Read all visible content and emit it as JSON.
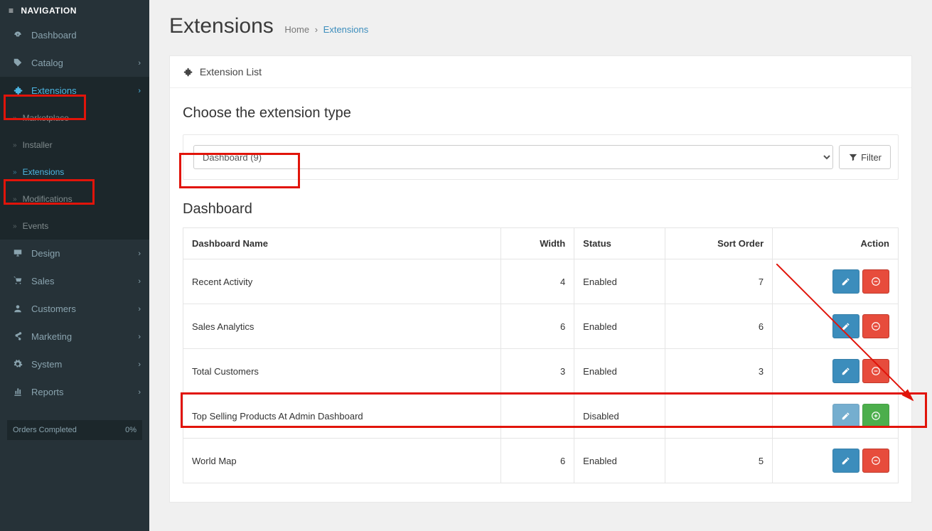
{
  "nav": {
    "header": "NAVIGATION",
    "items": [
      {
        "icon": "dashboard",
        "label": "Dashboard",
        "expand": false
      },
      {
        "icon": "tag",
        "label": "Catalog",
        "expand": true
      },
      {
        "icon": "puzzle",
        "label": "Extensions",
        "expand": true,
        "active": true
      },
      {
        "icon": "desktop",
        "label": "Design",
        "expand": true
      },
      {
        "icon": "cart",
        "label": "Sales",
        "expand": true
      },
      {
        "icon": "user",
        "label": "Customers",
        "expand": true
      },
      {
        "icon": "share",
        "label": "Marketing",
        "expand": true
      },
      {
        "icon": "gear",
        "label": "System",
        "expand": true
      },
      {
        "icon": "chart",
        "label": "Reports",
        "expand": true
      }
    ],
    "sub": [
      {
        "label": "Marketplace"
      },
      {
        "label": "Installer"
      },
      {
        "label": "Extensions",
        "active": true
      },
      {
        "label": "Modifications"
      },
      {
        "label": "Events"
      }
    ],
    "orders": {
      "label": "Orders Completed",
      "value": "0%"
    }
  },
  "page": {
    "title": "Extensions",
    "breadcrumb": {
      "home": "Home",
      "sep": "›",
      "current": "Extensions"
    }
  },
  "panel": {
    "head": "Extension List",
    "section": "Choose the extension type",
    "select": {
      "label": "Dashboard (9)"
    },
    "filter": "Filter",
    "subhead": "Dashboard"
  },
  "table": {
    "cols": [
      "Dashboard Name",
      "Width",
      "Status",
      "Sort Order",
      "Action"
    ],
    "rows": [
      {
        "name": "Recent Activity",
        "width": "4",
        "status": "Enabled",
        "sort": "7",
        "disabled": false
      },
      {
        "name": "Sales Analytics",
        "width": "6",
        "status": "Enabled",
        "sort": "6",
        "disabled": false
      },
      {
        "name": "Total Customers",
        "width": "3",
        "status": "Enabled",
        "sort": "3",
        "disabled": false
      },
      {
        "name": "Top Selling Products At Admin Dashboard",
        "width": "",
        "status": "Disabled",
        "sort": "",
        "disabled": true
      },
      {
        "name": "World Map",
        "width": "6",
        "status": "Enabled",
        "sort": "5",
        "disabled": false
      }
    ]
  }
}
